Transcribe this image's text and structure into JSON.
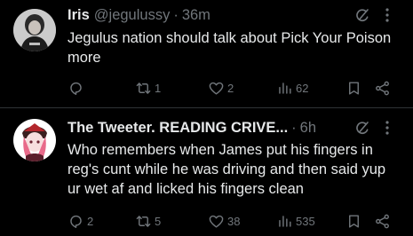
{
  "colors": {
    "background": "#000000",
    "text": "#e7e9ea",
    "muted": "#71767b",
    "divider": "#2f3336"
  },
  "posts": [
    {
      "display_name": "Iris",
      "handle": "@jegulussy",
      "separator": "·",
      "time": "36m",
      "text": "Jegulus nation should talk about Pick Your Poison more",
      "reply_count": "",
      "repost_count": "1",
      "like_count": "2",
      "view_count": "62",
      "icons": [
        "grok-icon",
        "more-icon",
        "reply-icon",
        "repost-icon",
        "like-icon",
        "views-icon",
        "bookmark-icon",
        "share-icon"
      ]
    },
    {
      "display_name": "The Tweeter. READING CRIVE...",
      "handle": "",
      "separator": "·",
      "time": "6h",
      "text": "Who remembers when James put his fingers in reg's cunt while he was driving and then said yup ur wet af and licked his fingers clean",
      "reply_count": "2",
      "repost_count": "5",
      "like_count": "38",
      "view_count": "535",
      "icons": [
        "grok-icon",
        "more-icon",
        "reply-icon",
        "repost-icon",
        "like-icon",
        "views-icon",
        "bookmark-icon",
        "share-icon"
      ]
    }
  ]
}
